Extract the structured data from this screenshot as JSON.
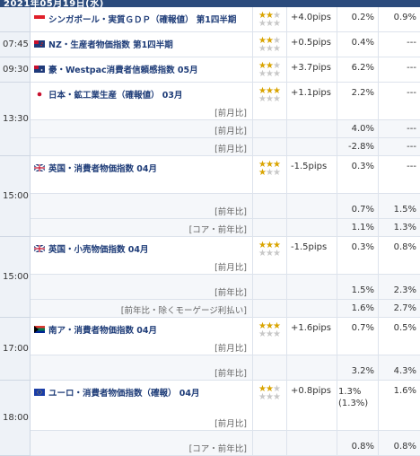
{
  "date": "2021年05月19日(水)",
  "colors": {
    "header": "#2b4b7c",
    "event_text": "#1e3c78",
    "star": "#d9a400"
  },
  "slots": [
    {
      "time": "",
      "rows": [
        {
          "flag": "sg",
          "event": "シンガポール・実質ＧＤＰ（確報値） 第1四半期",
          "stars_on": 2,
          "pips": "+4.0pips",
          "prev": "0.2%",
          "forecast": "0.9%"
        }
      ]
    },
    {
      "time": "07:45",
      "rows": [
        {
          "flag": "nz",
          "event": "NZ・生産者物価指数 第1四半期",
          "stars_on": 2,
          "pips": "+0.5pips",
          "prev": "0.4%",
          "forecast": "---"
        }
      ]
    },
    {
      "time": "09:30",
      "rows": [
        {
          "flag": "au",
          "event": "豪・Westpac消費者信頼感指数 05月",
          "stars_on": 2,
          "pips": "+3.7pips",
          "prev": "6.2%",
          "forecast": "---"
        }
      ]
    },
    {
      "time": "13:30",
      "rows": [
        {
          "flag": "jp",
          "event": "日本・鉱工業生産（確報値） 03月",
          "sub": "[前月比]",
          "stars_on": 3,
          "pips": "+1.1pips",
          "prev": "2.2%",
          "forecast": "---"
        },
        {
          "sub": "[前月比]",
          "prev": "4.0%",
          "forecast": "---"
        },
        {
          "sub": "[前月比]",
          "prev": "-2.8%",
          "forecast": "---"
        }
      ]
    },
    {
      "time": "15:00",
      "rows": [
        {
          "flag": "uk",
          "event": "英国・消費者物価指数 04月",
          "stars_on": 4,
          "pips": "-1.5pips",
          "prev": "0.3%",
          "forecast": "---"
        },
        {
          "sub": "[前年比]",
          "prev": "0.7%",
          "forecast": "1.5%"
        },
        {
          "sub": "[コア・前年比]",
          "prev": "1.1%",
          "forecast": "1.3%"
        }
      ]
    },
    {
      "time": "15:00",
      "rows": [
        {
          "flag": "uk",
          "event": "英国・小売物価指数 04月",
          "sub": "[前月比]",
          "stars_on": 3,
          "pips": "-1.5pips",
          "prev": "0.3%",
          "forecast": "0.8%"
        },
        {
          "sub": "[前年比]",
          "prev": "1.5%",
          "forecast": "2.3%"
        },
        {
          "sub": "[前年比・除くモーゲージ利払い]",
          "prev": "1.6%",
          "forecast": "2.7%"
        }
      ]
    },
    {
      "time": "17:00",
      "rows": [
        {
          "flag": "za",
          "event": "南ア・消費者物価指数 04月",
          "sub": "[前月比]",
          "stars_on": 3,
          "pips": "+1.6pips",
          "prev": "0.7%",
          "forecast": "0.5%"
        },
        {
          "sub": "[前年比]",
          "prev": "3.2%",
          "forecast": "4.3%"
        }
      ]
    },
    {
      "time": "18:00",
      "rows": [
        {
          "flag": "eu",
          "event": "ユーロ・消費者物価指数（確報） 04月",
          "sub": "[前月比]",
          "stars_on": 2,
          "pips": "+0.8pips",
          "prev": "1.3% (1.3%)",
          "forecast": "1.6%"
        },
        {
          "sub": "[コア・前年比]",
          "prev": "0.8%",
          "forecast": "0.8%"
        }
      ]
    }
  ]
}
